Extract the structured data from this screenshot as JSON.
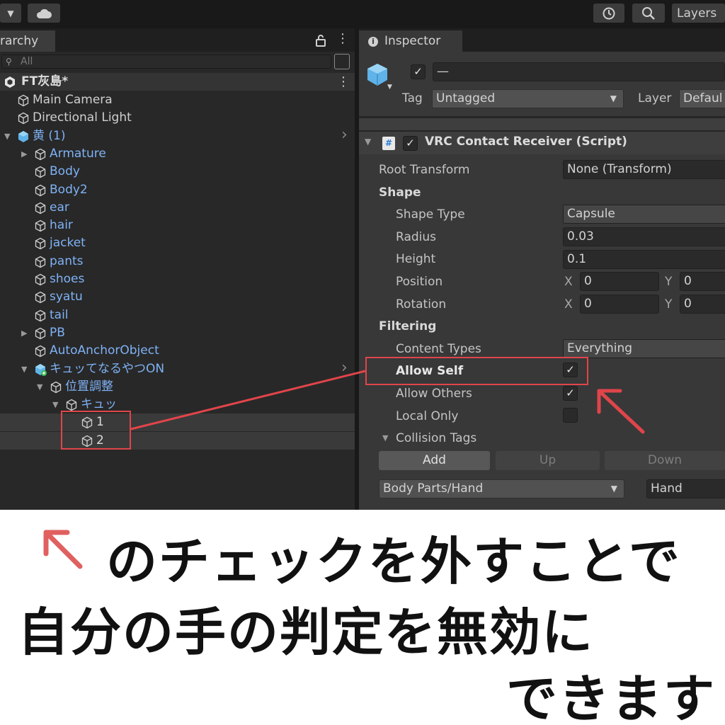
{
  "toolbar": {
    "dropdown_icon": "caret-down",
    "cloud_icon": "cloud",
    "history_icon": "history",
    "search_icon": "magnifier",
    "layers_label": "Layers"
  },
  "hierarchy": {
    "tab_label": "rarchy",
    "search_placeholder": "All",
    "scene_name": "FT灰島*",
    "items": [
      {
        "label": "Main Camera",
        "depth": 1
      },
      {
        "label": "Directional Light",
        "depth": 1
      },
      {
        "label": "黄 (1)",
        "depth": 1
      },
      {
        "label": "Armature",
        "depth": 2
      },
      {
        "label": "Body",
        "depth": 2
      },
      {
        "label": "Body2",
        "depth": 2
      },
      {
        "label": "ear",
        "depth": 2
      },
      {
        "label": "hair",
        "depth": 2
      },
      {
        "label": "jacket",
        "depth": 2
      },
      {
        "label": "pants",
        "depth": 2
      },
      {
        "label": "shoes",
        "depth": 2
      },
      {
        "label": "syatu",
        "depth": 2
      },
      {
        "label": "tail",
        "depth": 2
      },
      {
        "label": "PB",
        "depth": 2
      },
      {
        "label": "AutoAnchorObject",
        "depth": 2
      },
      {
        "label": "キュッてなるやつON",
        "depth": 2
      },
      {
        "label": "位置調整",
        "depth": 3
      },
      {
        "label": "キュッ",
        "depth": 4
      },
      {
        "label": "1",
        "depth": 5
      },
      {
        "label": "2",
        "depth": 5
      }
    ]
  },
  "inspector": {
    "tab_label": "Inspector",
    "object_name": "—",
    "tag_label": "Tag",
    "tag_value": "Untagged",
    "layer_label": "Layer",
    "layer_value": "Defaul",
    "component_title": "VRC Contact Receiver (Script)",
    "root_transform_label": "Root Transform",
    "root_transform_value": "None (Transform)",
    "shape_header": "Shape",
    "shape_type_label": "Shape Type",
    "shape_type_value": "Capsule",
    "radius_label": "Radius",
    "radius_value": "0.03",
    "height_label": "Height",
    "height_value": "0.1",
    "position_label": "Position",
    "position_x": "0",
    "position_y": "0",
    "rotation_label": "Rotation",
    "rotation_x": "0",
    "rotation_y": "0",
    "axis_x": "X",
    "axis_y": "Y",
    "filtering_header": "Filtering",
    "content_types_label": "Content Types",
    "content_types_value": "Everything",
    "allow_self_label": "Allow Self",
    "allow_self_checked": true,
    "allow_others_label": "Allow Others",
    "allow_others_checked": true,
    "local_only_label": "Local Only",
    "local_only_checked": false,
    "collision_tags_label": "Collision Tags",
    "add_label": "Add",
    "up_label": "Up",
    "down_label": "Down",
    "tag_select_value": "Body Parts/Hand",
    "tag_text_value": "Hand"
  },
  "colors": {
    "annotation_red": "#e0454a",
    "link_blue": "#7fb2f5",
    "panel_dark": "#282828",
    "inspector_bg": "#383838"
  },
  "caption": {
    "line1": "のチェックを外すことで",
    "line2": "自分の手の判定を無効に",
    "line3": "できます"
  }
}
